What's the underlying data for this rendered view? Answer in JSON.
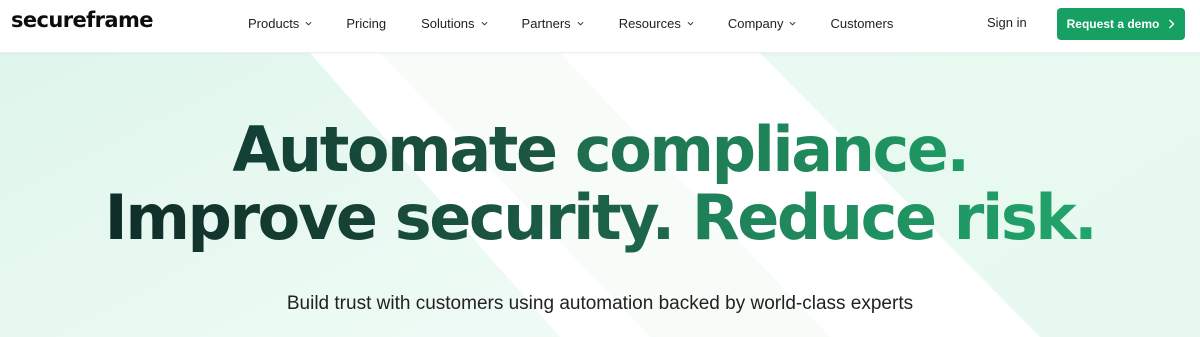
{
  "brand": {
    "logo_text": "secureframe"
  },
  "nav": {
    "items": [
      {
        "label": "Products",
        "has_dropdown": true
      },
      {
        "label": "Pricing",
        "has_dropdown": false
      },
      {
        "label": "Solutions",
        "has_dropdown": true
      },
      {
        "label": "Partners",
        "has_dropdown": true
      },
      {
        "label": "Resources",
        "has_dropdown": true
      },
      {
        "label": "Company",
        "has_dropdown": true
      },
      {
        "label": "Customers",
        "has_dropdown": false
      }
    ],
    "signin_label": "Sign in",
    "cta_label": "Request a demo",
    "cta_icon": "chevron-right-icon"
  },
  "hero": {
    "headline_line1_part1": "Automate ",
    "headline_line1_part2": "compliance.",
    "headline_line2_part1": "Improve ",
    "headline_line2_part2": "security. ",
    "headline_line2_part3": "Reduce risk.",
    "subtitle": "Build trust with customers using automation backed by world-class experts"
  },
  "colors": {
    "accent_green": "#16a062",
    "headline_dark": "#0f2d28",
    "headline_light": "#21a56b",
    "background_mint": "#e8f8f0"
  }
}
